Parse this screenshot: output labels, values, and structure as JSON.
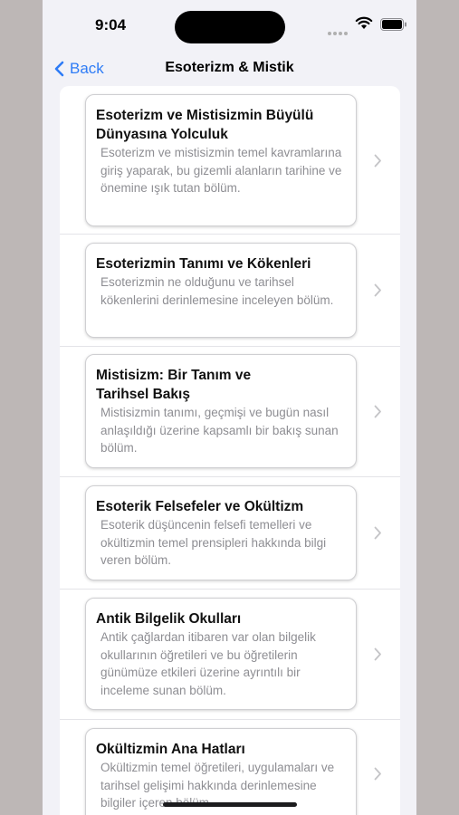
{
  "status": {
    "time": "9:04"
  },
  "nav": {
    "back_label": "Back",
    "title": "Esoterizm & Mistik"
  },
  "items": [
    {
      "title": "Esoterizm ve Mistisizmin Büyülü Dünyasına Yolculuk",
      "description": "Esoterizm ve mistisizmin temel kavramlarına giriş yaparak, bu gizemli alanların tarihine ve önemine ışık tutan bölüm."
    },
    {
      "title": "Esoterizmin Tanımı ve Kökenleri",
      "description": "Esoterizmin ne olduğunu ve tarihsel kökenlerini derinlemesine inceleyen bölüm."
    },
    {
      "title": "Mistisizm: Bir Tanım ve Tarihsel Bakış",
      "description": "Mistisizmin tanımı, geçmişi ve bugün nasıl anlaşıldığı üzerine kapsamlı bir bakış sunan bölüm."
    },
    {
      "title": "Esoterik Felsefeler ve Okültizm",
      "description": "Esoterik düşüncenin felsefi temelleri ve okültizmin temel prensipleri hakkında bilgi veren bölüm."
    },
    {
      "title": "Antik Bilgelik Okulları",
      "description": "Antik çağlardan itibaren var olan bilgelik okullarının öğretileri ve bu öğretilerin günümüze etkileri üzerine ayrıntılı bir inceleme sunan bölüm."
    },
    {
      "title": "Okültizmin Ana Hatları",
      "description": "Okültizmin temel öğretileri, uygulamaları ve tarihsel gelişimi hakkında derinlemesine bilgiler içeren bölüm."
    }
  ],
  "icons": {
    "back": "chevron-left-icon",
    "row_chevron": "chevron-right-icon"
  },
  "colors": {
    "accent": "#2e7cf6",
    "background": "#f2f2f7",
    "secondary_text": "#8e8e93"
  }
}
